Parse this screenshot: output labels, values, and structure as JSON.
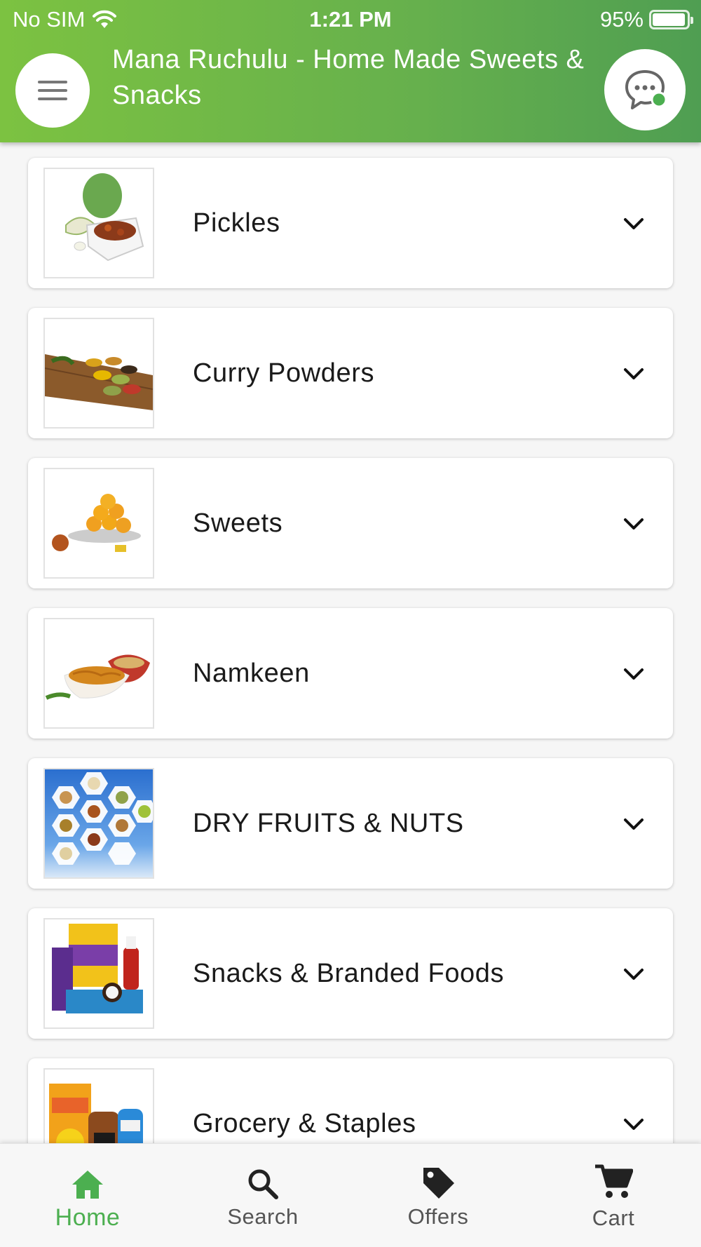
{
  "status_bar": {
    "carrier": "No SIM",
    "time": "1:21 PM",
    "battery": "95%",
    "battery_level": 0.95
  },
  "header": {
    "title": "Mana Ruchulu - Home Made Sweets & Snacks"
  },
  "categories": [
    {
      "label": "Pickles",
      "icon": "pickles-image"
    },
    {
      "label": "Curry Powders",
      "icon": "curry-powders-image"
    },
    {
      "label": "Sweets",
      "icon": "sweets-image"
    },
    {
      "label": "Namkeen",
      "icon": "namkeen-image"
    },
    {
      "label": "DRY FRUITS & NUTS",
      "icon": "dry-fruits-image"
    },
    {
      "label": "Snacks & Branded Foods",
      "icon": "snacks-branded-image"
    },
    {
      "label": "Grocery & Staples",
      "icon": "grocery-staples-image"
    }
  ],
  "bottom_nav": {
    "items": [
      {
        "label": "Home",
        "icon": "home-icon",
        "active": true
      },
      {
        "label": "Search",
        "icon": "search-icon",
        "active": false
      },
      {
        "label": "Offers",
        "icon": "tag-icon",
        "active": false
      },
      {
        "label": "Cart",
        "icon": "cart-icon",
        "active": false
      }
    ]
  },
  "colors": {
    "accent": "#4caf50",
    "header_start": "#7cc241",
    "header_end": "#4f9e52"
  }
}
